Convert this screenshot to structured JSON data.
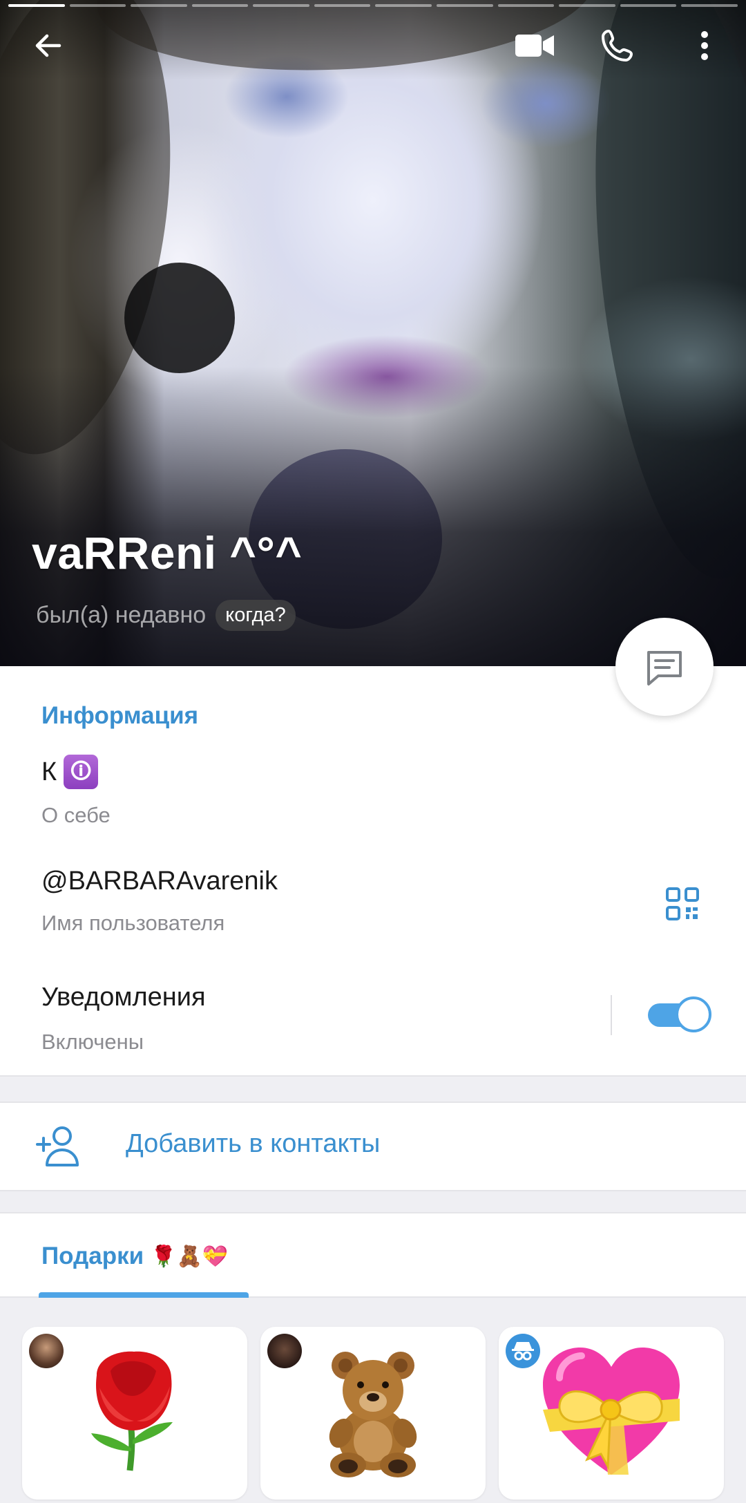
{
  "header": {
    "story_segments": 12,
    "active_segment": 0,
    "name": "vaRReni ^°^",
    "status": "был(а) недавно",
    "when_badge": "когда?"
  },
  "toolbar": {
    "back_icon": "back-arrow-icon",
    "video_icon": "video-call-icon",
    "phone_icon": "phone-icon",
    "menu_icon": "more-vert-icon",
    "message_icon": "message-icon"
  },
  "info": {
    "section_title": "Информация",
    "bio_value": "К",
    "bio_emoji": "🛈",
    "bio_label": "О себе",
    "username_value": "@BARBARAvarenik",
    "username_label": "Имя пользователя",
    "notifications_value": "Уведомления",
    "notifications_label": "Включены",
    "notifications_enabled": true
  },
  "contacts": {
    "add_label": "Добавить в контакты"
  },
  "gifts": {
    "tab_title": "Подарки",
    "tab_emojis": "🌹🧸💝",
    "items": [
      {
        "name": "rose-gift",
        "avatar": "user-avatar-1"
      },
      {
        "name": "teddy-bear-gift",
        "avatar": "user-avatar-2"
      },
      {
        "name": "heart-gift",
        "avatar": "anonymous-icon"
      }
    ]
  },
  "colors": {
    "accent": "#3a8fcf",
    "toggle": "#4ea4e6",
    "secondary_text": "#8b8b90"
  }
}
